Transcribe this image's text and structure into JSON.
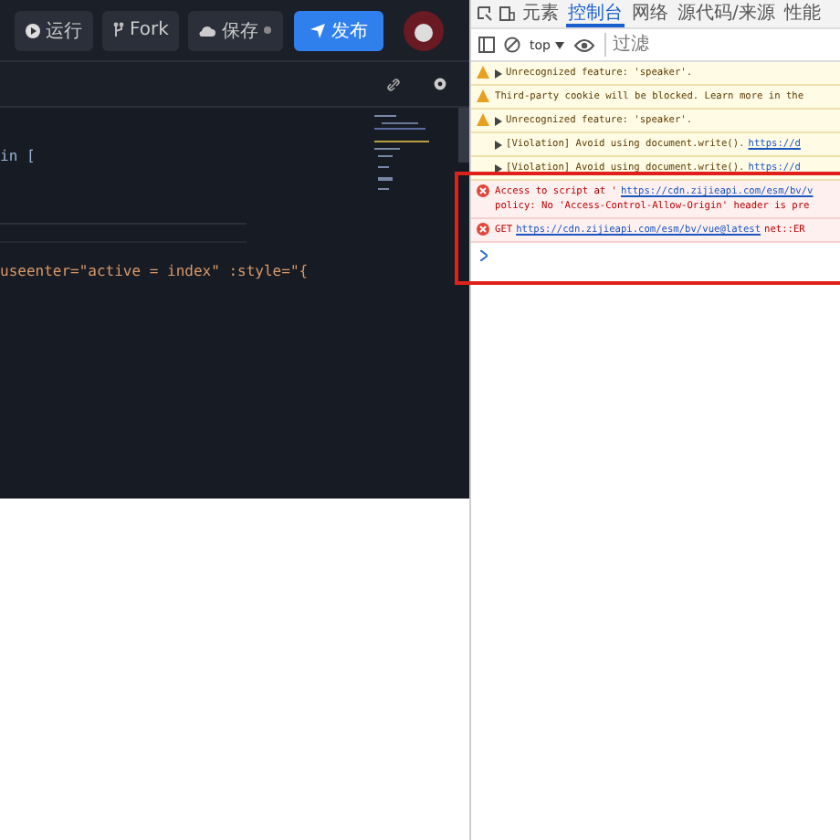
{
  "toolbar": {
    "buttons": [
      {
        "kind": "run",
        "label": "运行"
      },
      {
        "kind": "fork",
        "label": "Fork"
      },
      {
        "kind": "save",
        "label": "保存"
      },
      {
        "kind": "publish",
        "label": "发布"
      }
    ]
  },
  "editor": {
    "lines": [
      {
        "text": "in ["
      },
      {
        "text": "useenter=\"active = index\" :style=\"{"
      }
    ]
  },
  "devtools": {
    "tabs": [
      {
        "label": "元素",
        "selected": false
      },
      {
        "label": "控制台",
        "selected": true
      },
      {
        "label": "网络",
        "selected": false
      },
      {
        "label": "源代码/来源",
        "selected": false
      },
      {
        "label": "性能",
        "selected": false
      }
    ],
    "context": "top",
    "filter": {
      "placeholder": "过滤"
    },
    "messages": [
      {
        "kind": "warning",
        "expandable": true,
        "text": "Unrecognized feature: 'speaker'."
      },
      {
        "kind": "warning",
        "expandable": false,
        "text": "Third-party cookie will be blocked. Learn more in the"
      },
      {
        "kind": "warning",
        "expandable": true,
        "text": "Unrecognized feature: 'speaker'."
      },
      {
        "kind": "violation",
        "expandable": true,
        "text": "[Violation] Avoid using document.write().",
        "link": "https://d"
      },
      {
        "kind": "violation",
        "expandable": true,
        "text": "[Violation] Avoid using document.write().",
        "link": "https://d"
      },
      {
        "kind": "error",
        "expandable": false,
        "text": "Access to script at '",
        "link": "https://cdn.zijieapi.com/esm/bv/v",
        "more": "policy: No 'Access-Control-Allow-Origin' header is pre"
      },
      {
        "kind": "error",
        "expandable": false,
        "text": "GET",
        "link": "https://cdn.zijieapi.com/esm/bv/vue@latest",
        "after": "net::ER"
      }
    ]
  }
}
